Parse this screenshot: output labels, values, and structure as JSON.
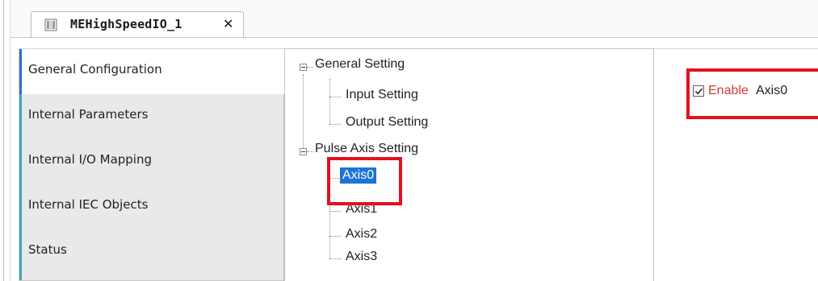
{
  "tab": {
    "title": "MEHighSpeedIO_1",
    "close_glyph": "✕",
    "icon": "device-module-icon"
  },
  "sidebar": {
    "items": [
      {
        "label": "General Configuration",
        "active": true
      },
      {
        "label": "Internal Parameters",
        "active": false
      },
      {
        "label": "Internal I/O Mapping",
        "active": false
      },
      {
        "label": "Internal IEC Objects",
        "active": false
      },
      {
        "label": "Status",
        "active": false
      }
    ]
  },
  "tree": {
    "general_setting": "General Setting",
    "input_setting": "Input Setting",
    "output_setting": "Output Setting",
    "pulse_axis_setting": "Pulse Axis Setting",
    "axes": [
      "Axis0",
      "Axis1",
      "Axis2",
      "Axis3"
    ],
    "selected": "Axis0"
  },
  "right_pane": {
    "enable_keyword": "Enable",
    "enable_axis": "Axis0",
    "enabled": true
  },
  "colors": {
    "highlight": "#e4101e",
    "selection": "#1e73d6",
    "enable_keyword": "#d33a3a"
  }
}
